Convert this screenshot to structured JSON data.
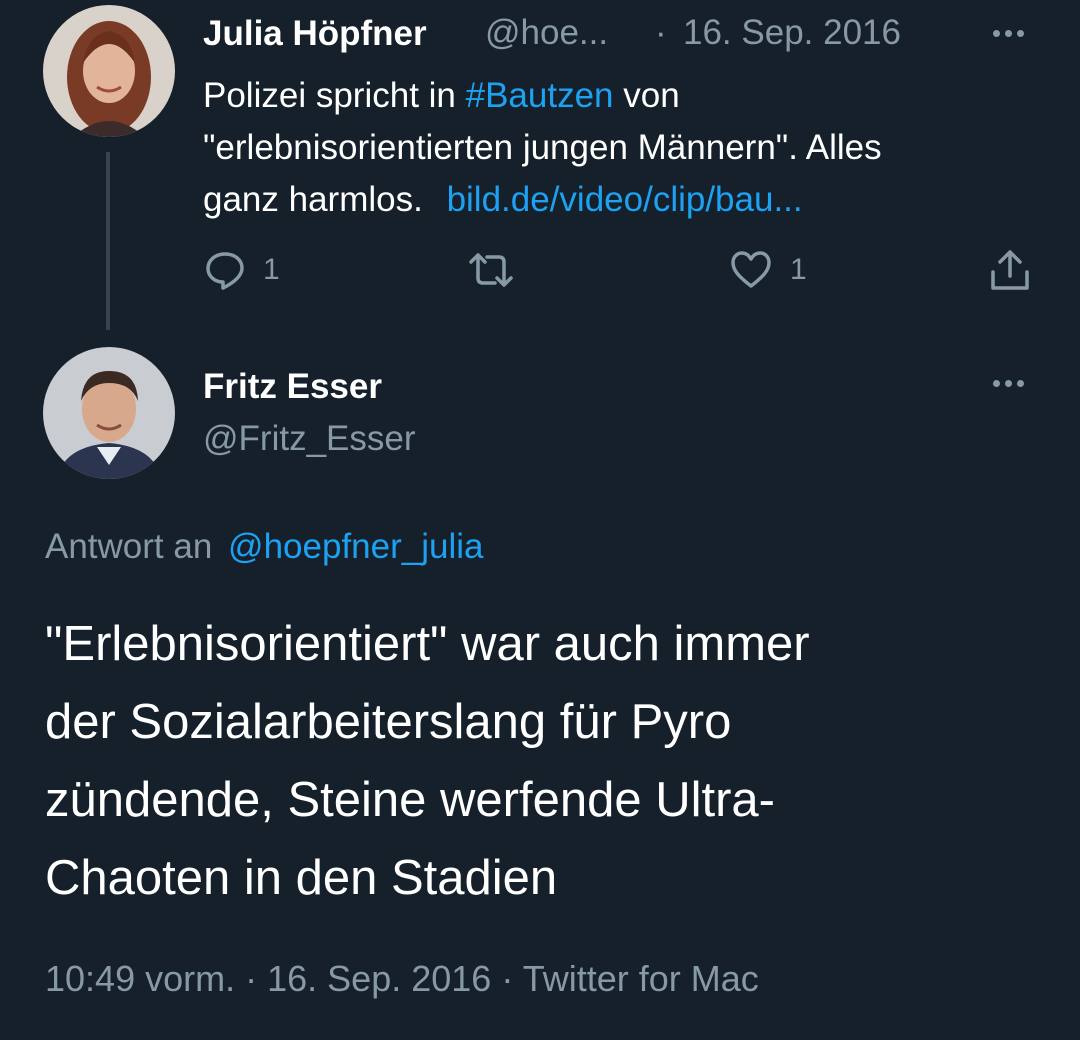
{
  "tweet1": {
    "name": "Julia Höpfner",
    "handle": "@hoe...",
    "separator": "·",
    "date": "16. Sep. 2016",
    "text_before": "Polizei spricht in ",
    "hashtag": "#Bautzen",
    "text_after_line1": " von",
    "text_line2": "\"erlebnisorientierten jungen Männern\". Alles",
    "text_line3": "ganz harmlos.",
    "url": "bild.de/video/clip/bau...",
    "reply_count": "1",
    "like_count": "1",
    "icons": [
      "reply-icon",
      "retweet-icon",
      "like-icon",
      "share-icon",
      "more-icon"
    ]
  },
  "tweet2": {
    "name": "Fritz Esser",
    "handle": "@Fritz_Esser",
    "reply_prefix": "Antwort an",
    "reply_to": "@hoepfner_julia",
    "text_line1": "\"Erlebnisorientiert\" war auch immer",
    "text_line2": "der Sozialarbeiterslang für Pyro",
    "text_line3": "zündende, Steine werfende Ultra-",
    "text_line4": "Chaoten in den Stadien",
    "time": "10:49 vorm.",
    "sep": "·",
    "date": "16. Sep. 2016",
    "sep2": "·",
    "source": "Twitter for Mac"
  },
  "colors": {
    "background": "#15202b",
    "text": "#ffffff",
    "muted": "#8899a6",
    "accent": "#1da1f2"
  }
}
